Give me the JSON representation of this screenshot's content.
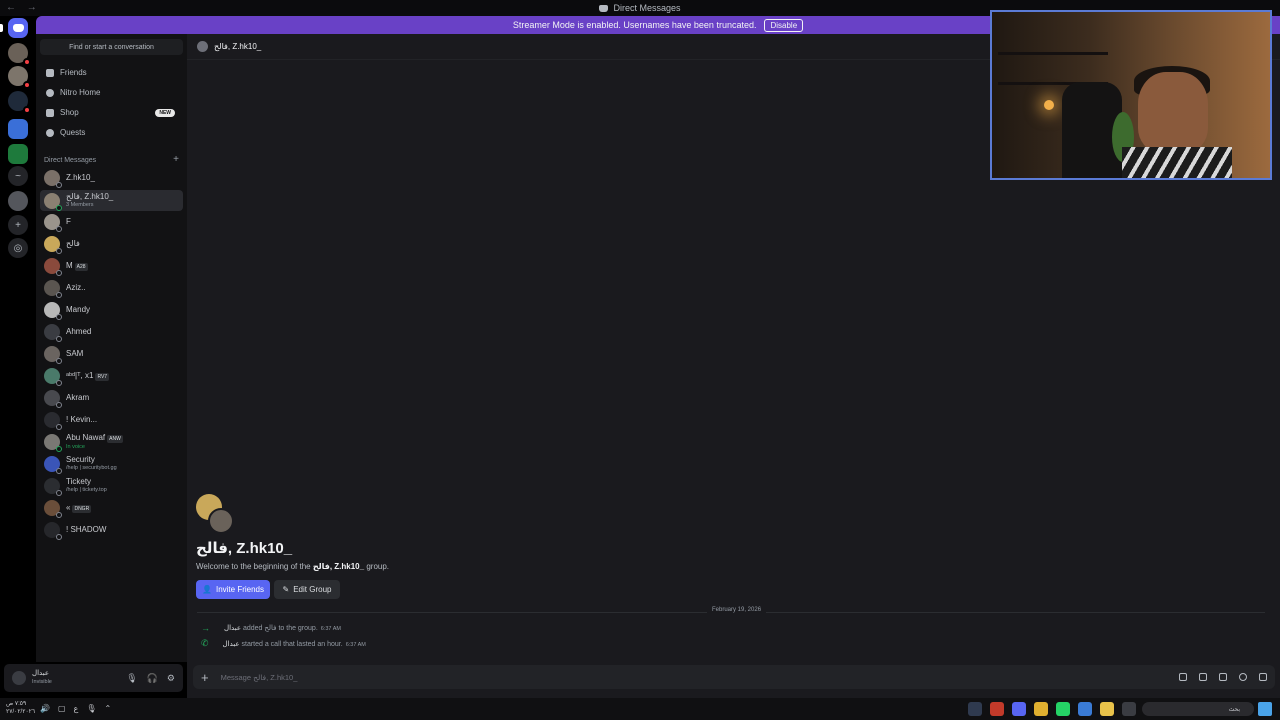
{
  "window": {
    "title": "Direct Messages",
    "nav": "← →"
  },
  "banner": {
    "text": "Streamer Mode is enabled. Usernames have been truncated.",
    "disable_label": "Disable"
  },
  "sidebar": {
    "search_label": "Find or start a conversation",
    "nav": [
      {
        "label": "Friends",
        "icon": "friends-icon"
      },
      {
        "label": "Nitro Home",
        "icon": "nitro-icon"
      },
      {
        "label": "Shop",
        "icon": "shop-icon",
        "badge": "NEW"
      },
      {
        "label": "Quests",
        "icon": "quests-icon"
      }
    ],
    "dm_header": "Direct Messages",
    "dms": [
      {
        "name": "Z.hk10_",
        "sub": "",
        "tag": ""
      },
      {
        "name": "فالح, Z.hk10_",
        "sub": "3 Members",
        "tag": ""
      },
      {
        "name": "F",
        "sub": "",
        "tag": ""
      },
      {
        "name": "فالح",
        "sub": "",
        "tag": ""
      },
      {
        "name": "M",
        "sub": "",
        "tag": "A28"
      },
      {
        "name": "Aziz..",
        "sub": "",
        "tag": ""
      },
      {
        "name": "Mandy",
        "sub": "",
        "tag": ""
      },
      {
        "name": "Ahmed",
        "sub": "",
        "tag": ""
      },
      {
        "name": "SAM",
        "sub": "",
        "tag": ""
      },
      {
        "name": "ᵃᵇᵈ|ᵀ, x1",
        "sub": "",
        "tag": "RV7"
      },
      {
        "name": "Akram",
        "sub": "",
        "tag": ""
      },
      {
        "name": "! Kevin...",
        "sub": "",
        "tag": ""
      },
      {
        "name": "Abu Nawaf",
        "sub": "In voice",
        "tag": "ANW"
      },
      {
        "name": "Security",
        "sub": "/help | securitybot.gg",
        "tag": ""
      },
      {
        "name": "Tickety",
        "sub": "/help | tickety.top",
        "tag": ""
      },
      {
        "name": "«",
        "sub": "",
        "tag": "DNGR"
      },
      {
        "name": "! SHADOW",
        "sub": "",
        "tag": ""
      }
    ]
  },
  "user_panel": {
    "name": "عبدال",
    "status": "Invisible"
  },
  "channel": {
    "header": "فالح, Z.hk10_",
    "welcome_title": "فالح, Z.hk10_",
    "welcome_prefix": "Welcome to the beginning of the",
    "welcome_group": "فالح, Z.hk10_",
    "welcome_suffix": "group.",
    "invite_label": "Invite Friends",
    "edit_label": "Edit Group",
    "date_divider": "February 19, 2026",
    "messages": [
      {
        "actor": "عبدال",
        "text": "added فالح to the group.",
        "time": "6:37 AM"
      },
      {
        "actor": "عبدال",
        "text": "started a call that lasted an hour.",
        "time": "6:37 AM"
      }
    ],
    "composer_placeholder": "Message فالح, Z.hk10_"
  },
  "taskbar": {
    "clock_time": "٧:٥٩ ص",
    "clock_date": "٢٧/٠٢/٢٠٢٦",
    "search_placeholder": "بحث"
  },
  "colors": {
    "accent": "#5865f2",
    "banner": "#6941c6",
    "online": "#23a55a"
  }
}
